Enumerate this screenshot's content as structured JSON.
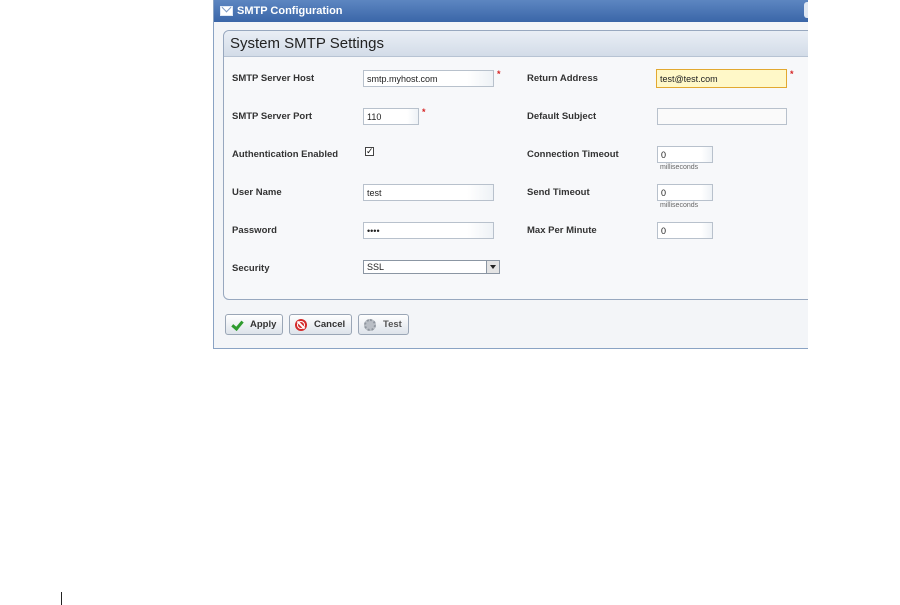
{
  "window": {
    "title": "SMTP Configuration",
    "panel_title": "System SMTP Settings"
  },
  "form": {
    "smtp_server_host": {
      "label": "SMTP Server Host",
      "value": "smtp.myhost.com",
      "required": "*"
    },
    "smtp_server_port": {
      "label": "SMTP Server Port",
      "value": "110",
      "required": "*"
    },
    "authentication_enabled": {
      "label": "Authentication Enabled",
      "checked": true,
      "mark": "✓"
    },
    "user_name": {
      "label": "User Name",
      "value": "test"
    },
    "password": {
      "label": "Password",
      "value": "••••"
    },
    "security": {
      "label": "Security",
      "value": "SSL"
    },
    "return_address": {
      "label": "Return Address",
      "value": "test@test.com",
      "required": "*"
    },
    "default_subject": {
      "label": "Default Subject",
      "value": ""
    },
    "connection_timeout": {
      "label": "Connection Timeout",
      "value": "0",
      "unit": "milliseconds"
    },
    "send_timeout": {
      "label": "Send Timeout",
      "value": "0",
      "unit": "milliseconds"
    },
    "max_per_minute": {
      "label": "Max Per Minute",
      "value": "0"
    }
  },
  "buttons": {
    "apply": "Apply",
    "cancel": "Cancel",
    "test": "Test"
  },
  "colors": {
    "titlebar": "#3a66a8",
    "highlight_field": "#fff8c8",
    "required_marker": "#d62424"
  },
  "icons": {
    "title": "mail-icon",
    "apply": "check-icon",
    "cancel": "cancel-icon",
    "test": "gear-icon"
  }
}
